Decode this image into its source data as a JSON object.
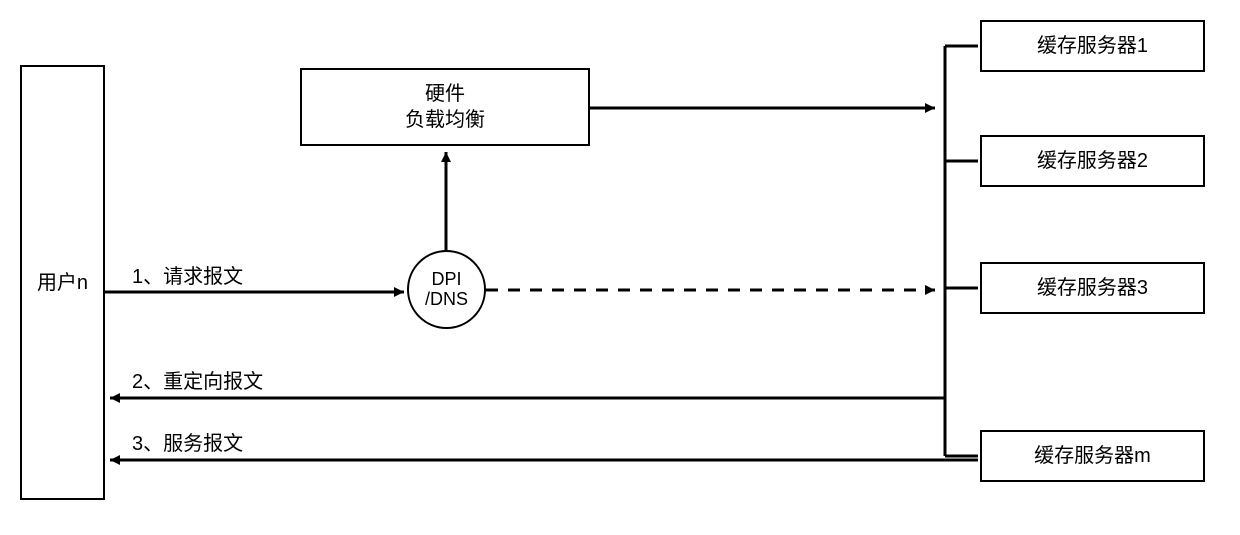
{
  "user": {
    "label": "用户n"
  },
  "load_balancer": {
    "line1": "硬件",
    "line2": "负载均衡"
  },
  "dpi": {
    "line1": "DPI",
    "line2": "/DNS"
  },
  "servers": {
    "s1": "缓存服务器1",
    "s2": "缓存服务器2",
    "s3": "缓存服务器3",
    "sm": "缓存服务器m"
  },
  "flows": {
    "step1": "1、请求报文",
    "step2": "2、重定向报文",
    "step3": "3、服务报文"
  }
}
